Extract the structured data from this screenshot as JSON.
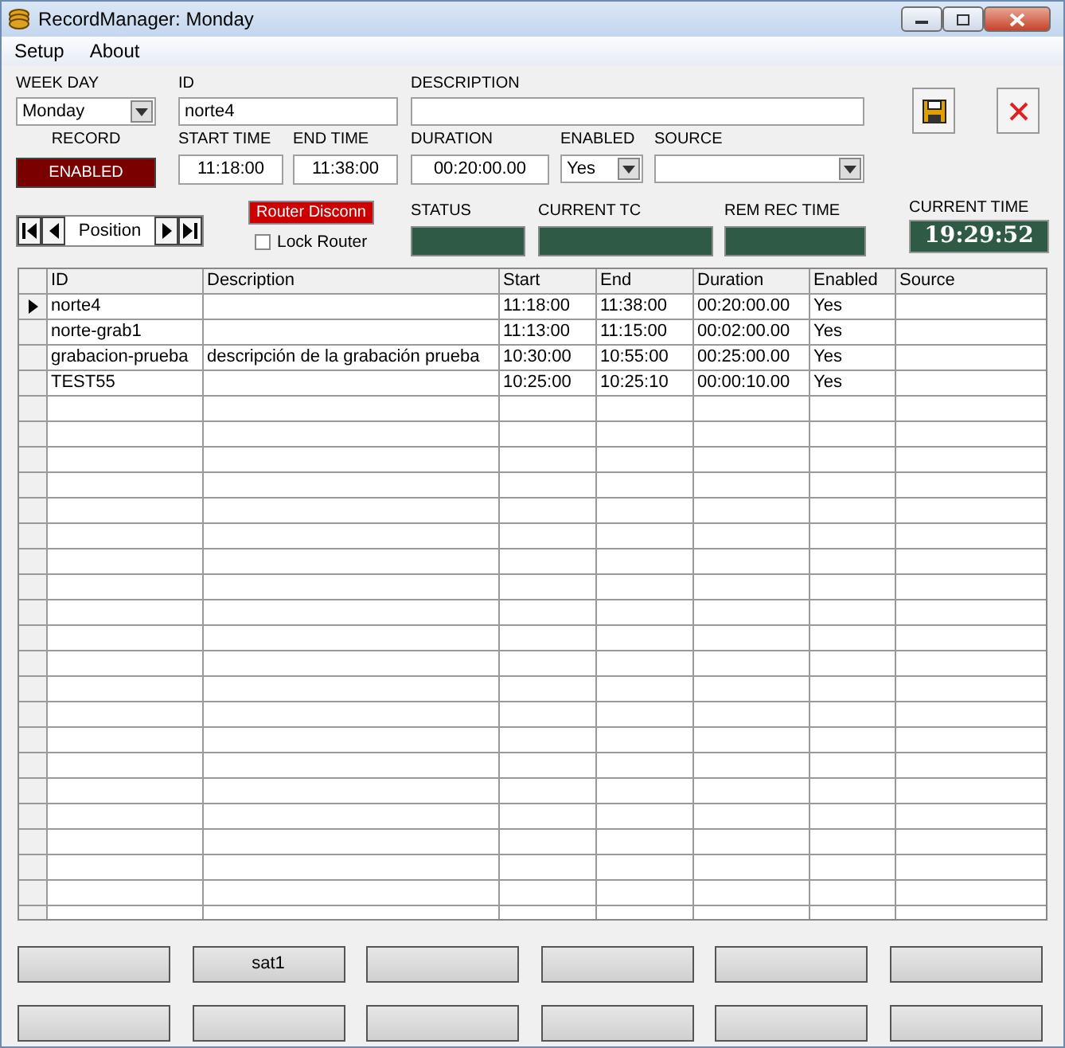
{
  "window": {
    "title": "RecordManager: Monday"
  },
  "menu": [
    "Setup",
    "About"
  ],
  "form": {
    "week_day": {
      "label": "WEEK DAY",
      "value": "Monday"
    },
    "id": {
      "label": "ID",
      "value": "norte4"
    },
    "description": {
      "label": "DESCRIPTION"
    },
    "record": {
      "label": "RECORD",
      "button": "ENABLED"
    },
    "start_time": {
      "label": "START TIME",
      "value": "11:18:00"
    },
    "end_time": {
      "label": "END TIME",
      "value": "11:38:00"
    },
    "duration": {
      "label": "DURATION",
      "value": "00:20:00.00"
    },
    "enabled": {
      "label": "ENABLED",
      "value": "Yes"
    },
    "source": {
      "label": "SOURCE"
    },
    "navigator": {
      "label": "Position"
    },
    "router_button": "Router Disconn",
    "lock_router": {
      "label": "Lock Router",
      "checked": false
    },
    "status": {
      "label": "STATUS"
    },
    "current_tc": {
      "label": "CURRENT TC"
    },
    "rem_rec_time": {
      "label": "REM REC TIME"
    },
    "current_time": {
      "label": "CURRENT TIME",
      "value": "19:29:52"
    }
  },
  "table": {
    "columns": [
      "ID",
      "Description",
      "Start",
      "End",
      "Duration",
      "Enabled",
      "Source"
    ],
    "rows": [
      {
        "selected": true,
        "cells": [
          "norte4",
          null,
          "11:18:00",
          "11:38:00",
          "00:20:00.00",
          "Yes",
          null
        ]
      },
      {
        "selected": false,
        "cells": [
          "norte-grab1",
          null,
          "11:13:00",
          "11:15:00",
          "00:02:00.00",
          "Yes",
          null
        ]
      },
      {
        "selected": false,
        "cells": [
          "grabacion-prueba",
          "descripción de la grabación prueba",
          "10:30:00",
          "10:55:00",
          "00:25:00.00",
          "Yes",
          null
        ]
      },
      {
        "selected": false,
        "cells": [
          "TEST55",
          null,
          "10:25:00",
          "10:25:10",
          "00:00:10.00",
          "Yes",
          null
        ]
      }
    ]
  },
  "button_rows": [
    {
      "buttons": [
        {
          "kind": "blank"
        },
        {
          "kind": "labeled",
          "label": "sat1"
        },
        {
          "kind": "blank"
        },
        {
          "kind": "blank"
        },
        {
          "kind": "blank"
        },
        {
          "kind": "blank"
        }
      ]
    },
    {
      "buttons": [
        {
          "kind": "blank"
        },
        {
          "kind": "blank"
        },
        {
          "kind": "blank"
        },
        {
          "kind": "blank"
        },
        {
          "kind": "blank"
        },
        {
          "kind": "blank"
        }
      ]
    }
  ]
}
